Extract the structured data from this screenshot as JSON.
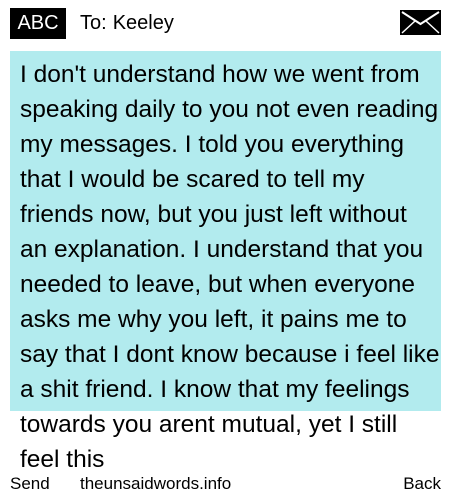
{
  "header": {
    "input_mode": "ABC",
    "to_label": "To:",
    "recipient": "Keeley",
    "envelope_icon": "envelope-icon"
  },
  "message": {
    "body": "I don't understand how we went from speaking daily to you not even reading my messages. I told you everything that I would be scared to tell my friends now, but you just left without an explanation. I understand that you needed to leave, but when everyone asks me why you left, it pains me to say that I dont know because i feel like a shit friend. I know that my feelings towards you arent mutual, yet I still feel this"
  },
  "softkeys": {
    "left": "Send",
    "center": "theunsaidwords.info",
    "right": "Back"
  },
  "colors": {
    "message_background": "#b2ebee",
    "badge_background": "#000000"
  }
}
